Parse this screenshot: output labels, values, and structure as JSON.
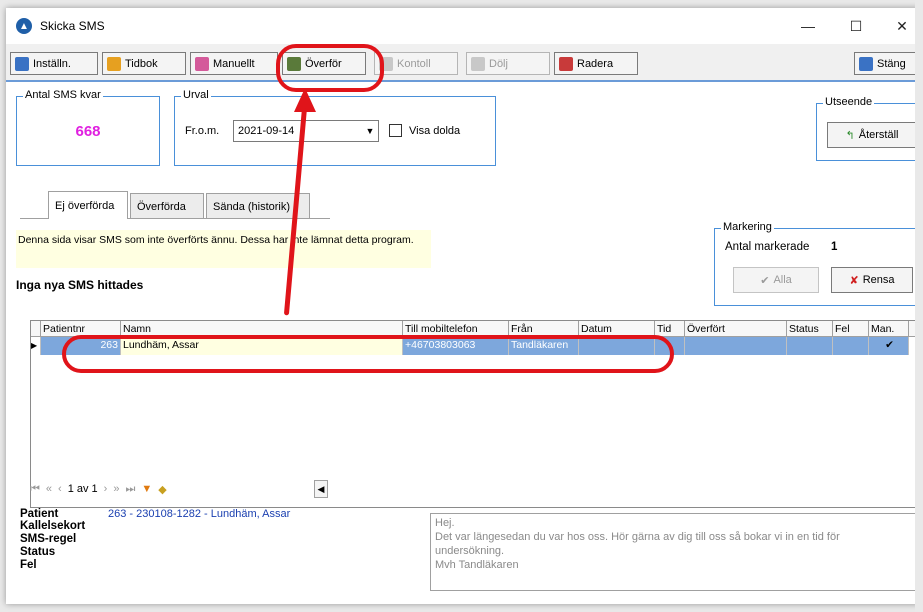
{
  "window": {
    "title": "Skicka SMS",
    "minimize": "—",
    "maximize": "☐",
    "close": "✕"
  },
  "toolbar": {
    "installn": "Inställn.",
    "tidbok": "Tidbok",
    "manuellt": "Manuellt",
    "overfor": "Överför",
    "kontroll": "Kontoll",
    "dolj": "Dölj",
    "radera": "Radera",
    "stang": "Stäng"
  },
  "sms_left": {
    "label": "Antal SMS kvar",
    "value": "668"
  },
  "urval": {
    "label": "Urval",
    "from_label": "Fr.o.m.",
    "date_value": "2021-09-14",
    "show_hidden_label": "Visa dolda"
  },
  "utseende": {
    "label": "Utseende",
    "reset_button": "Återställ"
  },
  "tabs": [
    "Ej överförda",
    "Överförda",
    "Sända (historik)"
  ],
  "info_text": "Denna sida visar SMS som inte överförts ännu. Dessa har inte lämnat detta program.",
  "no_sms_text": "Inga nya SMS hittades",
  "markering": {
    "label": "Markering",
    "count_label": "Antal markerade",
    "count_value": "1",
    "all_button": "Alla",
    "clear_button": "Rensa"
  },
  "grid": {
    "columns": [
      "Patientnr",
      "Namn",
      "Till mobiltelefon",
      "Från",
      "Datum",
      "Tid",
      "Överfört",
      "Status",
      "Fel",
      "Man."
    ],
    "rows": [
      {
        "patientnr": "263",
        "namn": "Lundhäm, Assar",
        "mobil": "+46703803063",
        "fran": "Tandläkaren",
        "datum": "",
        "tid": "",
        "overfort": "",
        "status": "",
        "fel": "",
        "man": "✔"
      }
    ]
  },
  "pager": {
    "text": "1 av 1"
  },
  "details": {
    "patient_label": "Patient",
    "patient_value": "263 - 230108-1282 - Lundhäm, Assar",
    "kallelsekort_label": "Kallelsekort",
    "smsregel_label": "SMS-regel",
    "status_label": "Status",
    "fel_label": "Fel"
  },
  "message": "Hej.\nDet var längesedan du var hos oss. Hör gärna av dig till oss så bokar vi in en tid för undersökning.\nMvh Tandläkaren",
  "colors": {
    "accent": "#4a90d9",
    "sms_count": "#e020e0",
    "highlight": "#e0141a",
    "selected_row": "#7da7dc"
  }
}
